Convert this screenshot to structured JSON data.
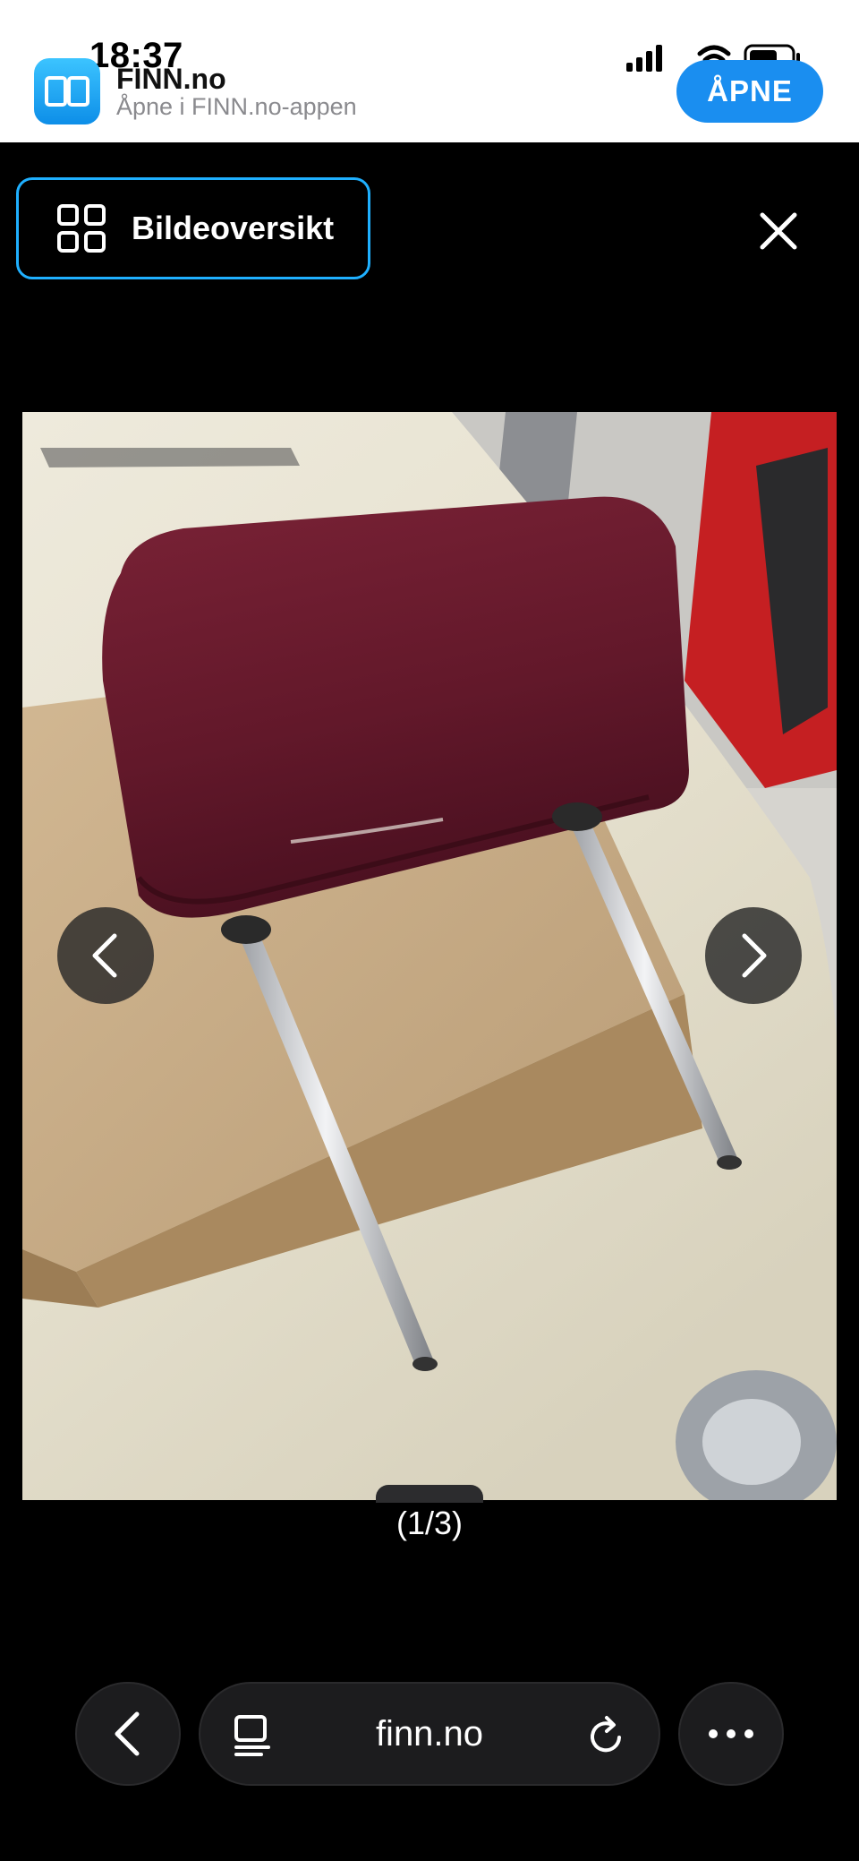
{
  "status_bar": {
    "time": "18:37"
  },
  "app_banner": {
    "app_name": "FINN.no",
    "subtitle": "Åpne i FINN.no-appen",
    "open_label": "ÅPNE",
    "accent_color": "#1a8ef0",
    "icon": "finn-book-icon"
  },
  "gallery": {
    "overview_label": "Bildeoversikt",
    "overview_icon": "grid-icon",
    "close_icon": "close-icon",
    "prev_icon": "chevron-left-icon",
    "next_icon": "chevron-right-icon",
    "counter": "(1/3)",
    "current_index": 1,
    "total_images": 3,
    "border_color": "#1fb0ff"
  },
  "browser_toolbar": {
    "url": "finn.no",
    "back_icon": "chevron-left-icon",
    "reader_icon": "reader-mode-icon",
    "reload_icon": "reload-icon",
    "more_icon": "more-icon"
  }
}
